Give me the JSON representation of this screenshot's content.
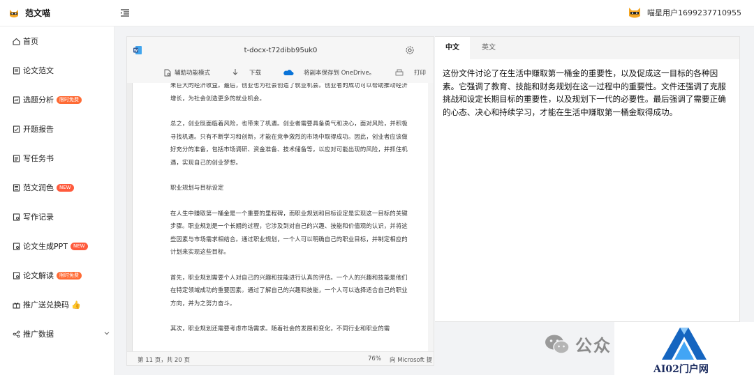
{
  "app": {
    "name": "范文喵"
  },
  "user": {
    "name": "喵星用户1699237710955"
  },
  "sidebar": {
    "items": [
      {
        "label": "首页",
        "icon": "home-icon"
      },
      {
        "label": "论文范文",
        "icon": "paper-icon"
      },
      {
        "label": "选题分析",
        "icon": "analysis-icon",
        "badge": "限时免费"
      },
      {
        "label": "开题报告",
        "icon": "report-icon"
      },
      {
        "label": "写任务书",
        "icon": "task-icon"
      },
      {
        "label": "范文润色",
        "icon": "polish-icon",
        "badge": "NEW"
      },
      {
        "label": "写作记录",
        "icon": "record-icon"
      },
      {
        "label": "论文生成PPT",
        "icon": "ppt-icon",
        "badge": "NEW"
      },
      {
        "label": "论文解读",
        "icon": "interpret-icon",
        "badge": "限时免费"
      },
      {
        "label": "推广送兑换码",
        "icon": "gift-icon"
      },
      {
        "label": "推广数据",
        "icon": "share-icon"
      }
    ]
  },
  "doc": {
    "filename": "t-docx-t72dibb95uk0",
    "toolbar": {
      "accessibility": "辅助功能模式",
      "download": "下载",
      "save_onedrive": "将副本保存到 OneDrive。",
      "print": "打印"
    },
    "paragraphs": [
      "来巨大的经济收益。最后，创业也为社会创造了就业机会。创业者的成功可以帮助推动经济增长，为社会创造更多的就业机会。",
      "总之，创业既面临着风险，也带来了机遇。创业者需要具备勇气和决心，面对风险，并积极寻找机遇。只有不断学习和创新，才能在竞争激烈的市场中取得成功。因此，创业者应该做好充分的准备，包括市场调研、资金准备、技术储备等，以应对可能出现的风险，并抓住机遇，实现自己的创业梦想。",
      "职业规划与目标设定",
      "在人生中赚取第一桶金是一个重要的里程碑，而职业规划和目标设定是实现这一目标的关键步骤。职业规划是一个长期的过程，它涉及到对自己的兴趣、技能和价值观的认识，并将这些因素与市场需求相结合。通过职业规划，一个人可以明确自己的职业目标，并制定相应的计划来实现这些目标。",
      "首先，职业规划需要个人对自己的兴趣和技能进行认真的评估。一个人的兴趣和技能是他们在特定领域成功的重要因素。通过了解自己的兴趣和技能，一个人可以选择适合自己的职业方向，并为之努力奋斗。",
      "其次，职业规划还需要考虑市场需求。随着社会的发展和变化，不同行业和职业的需"
    ],
    "footer": {
      "page_info": "第 11 页，共 20 页",
      "zoom": "76%",
      "feedback": "向 Microsoft 提"
    }
  },
  "translation": {
    "tabs": [
      "中文",
      "英文"
    ],
    "active_tab": "中文",
    "text": "这份文件讨论了在生活中赚取第一桶金的重要性，以及促成这一目标的各种因素。它强调了教育、技能和财务规划在这一过程中的重要性。文件还强调了克服挑战和设定长期目标的重要性，以及规划下一代的必要性。最后强调了需要正确的心态、决心和持续学习，才能在生活中赚取第一桶金取得成功。"
  },
  "watermark": {
    "text": "公众",
    "brand": "AI02门户网"
  },
  "colors": {
    "badge_orange": "#ff6b35",
    "word_blue": "#2b5797",
    "onedrive_blue": "#0a74d8",
    "brand_blue": "#1e88e5"
  }
}
